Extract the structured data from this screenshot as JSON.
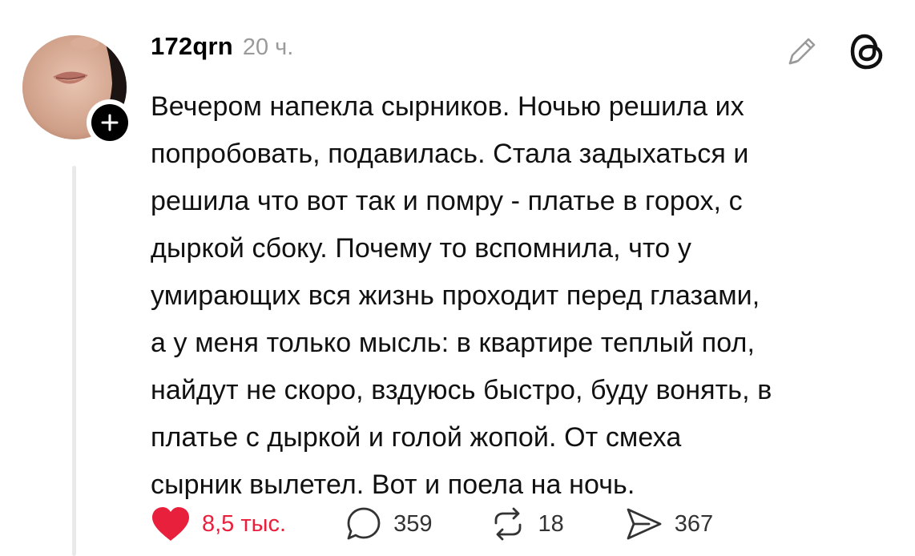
{
  "post": {
    "username": "172qrn",
    "time": "20 ч.",
    "text": "Вечером напекла сырников. Ночью решила их\nпопробовать, подавилась. Стала задыхаться и\nрешила что вот так и помру - платье в горох, с\nдыркой сбоку. Почему то вспомнила, что у\nумирающих вся жизнь проходит перед глазами,\nа у меня только мысль: в квартире теплый пол,\nнайдут не скоро, вздуюсь быстро, буду вонять, в\nплатье с дыркой и голой жопой. От смеха\nсырник вылетел. Вот и поела на ночь."
  },
  "actions": {
    "likes": "8,5 тыс.",
    "replies": "359",
    "reposts": "18",
    "shares": "367"
  },
  "colors": {
    "like": "#e8203c",
    "muted": "#9a9a9a",
    "text": "#111111"
  },
  "icons": [
    "plus-icon",
    "edit-icon",
    "threads-logo-icon",
    "heart-icon",
    "comment-icon",
    "repost-icon",
    "share-icon"
  ]
}
